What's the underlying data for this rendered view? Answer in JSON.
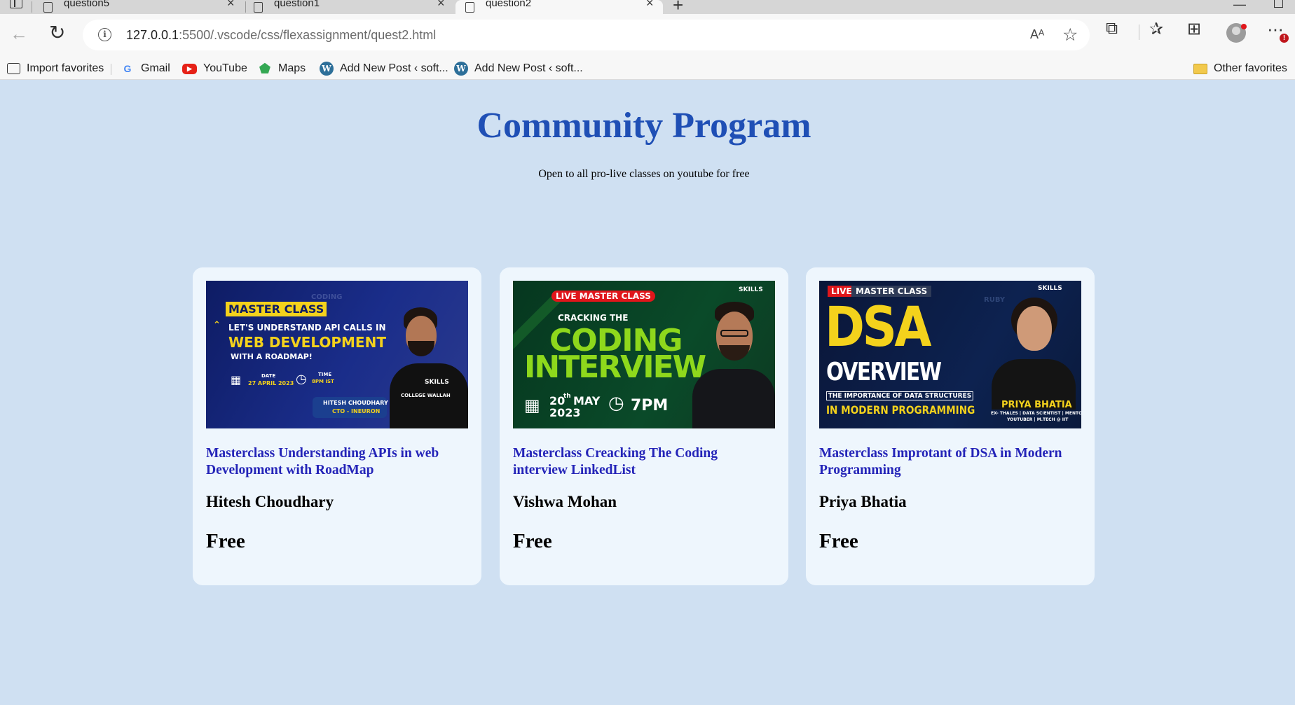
{
  "browser": {
    "tabs": [
      {
        "label": "question5",
        "close": "×"
      },
      {
        "label": "question1",
        "close": "×"
      },
      {
        "label": "question2",
        "close": "×"
      }
    ],
    "new_tab": "+",
    "url_host": "127.0.0.1",
    "url_rest": ":5500/.vscode/css/flexassignment/quest2.html",
    "read_aloud": "Aᴬ",
    "menu_badge": "!",
    "icons": [
      "sidebar-toggle-icon",
      "doc-icon",
      "close-icon",
      "plus-icon",
      "back-arrow-icon",
      "reload-icon",
      "info-icon",
      "read-aloud-icon",
      "add-favorite-icon",
      "extensions-icon",
      "favorites-icon",
      "collections-icon",
      "profile-icon",
      "more-icon"
    ],
    "favorites": [
      {
        "label": "Import favorites",
        "icon": "import-icon"
      },
      {
        "label": "Gmail",
        "icon": "google-icon"
      },
      {
        "label": "YouTube",
        "icon": "youtube-icon"
      },
      {
        "label": "Maps",
        "icon": "maps-icon"
      },
      {
        "label": "Add New Post ‹ soft...",
        "icon": "wordpress-icon"
      },
      {
        "label": "Add New Post ‹ soft...",
        "icon": "wordpress-icon"
      }
    ],
    "other_favorites": "Other favorites"
  },
  "page": {
    "title": "Community Program",
    "subtitle": "Open to all pro-live classes on youtube for free",
    "background": "#cfe0f2",
    "title_color": "#1f4fb5",
    "link_color": "#2424b8",
    "cards": [
      {
        "title": "Masterclass Understanding APIs in web Development with RoadMap",
        "author": "Hitesh Choudhary",
        "price": "Free",
        "thumb": {
          "badge": "MASTER CLASS",
          "line1": "LET'S UNDERSTAND API CALLS IN",
          "line2": "WEB DEVELOPMENT",
          "line3": "WITH A ROADMAP!",
          "date_label": "DATE",
          "date": "27 APRIL 2023",
          "time_label": "TIME",
          "time": "8PM IST",
          "name": "HITESH CHOUDHARY",
          "role": "CTO - INEURON",
          "bg_word": "CODING",
          "shirt": "COLLEGE WALLAH",
          "skills": "SKILLS"
        }
      },
      {
        "title": "Masterclass Creacking The Coding interview LinkedList",
        "author": "Vishwa Mohan",
        "price": "Free",
        "thumb": {
          "badge": "LIVE MASTER CLASS",
          "line1": "CRACKING THE",
          "line2": "CODING",
          "line3": "INTERVIEW",
          "date_day": "20",
          "date_sup": "th",
          "date_month": "MAY",
          "date_year": "2023",
          "time": "7PM",
          "skills": "SKILLS"
        }
      },
      {
        "title": "Masterclass Improtant of DSA in Modern Programming",
        "author": "Priya Bhatia",
        "price": "Free",
        "thumb": {
          "badge_live": "LIVE",
          "badge": "MASTER CLASS",
          "line1": "DSA",
          "line2": "OVERVIEW",
          "line3": "THE IMPORTANCE OF DATA STRUCTURES",
          "line4": "IN MODERN PROGRAMMING",
          "name": "PRIYA BHATIA",
          "role": "EX- THALES | DATA SCIENTIST | MENTOR",
          "role2": "YOUTUBER | M.TECH @ IIT",
          "bg_word": "RUBY",
          "skills": "SKILLS"
        }
      }
    ]
  }
}
